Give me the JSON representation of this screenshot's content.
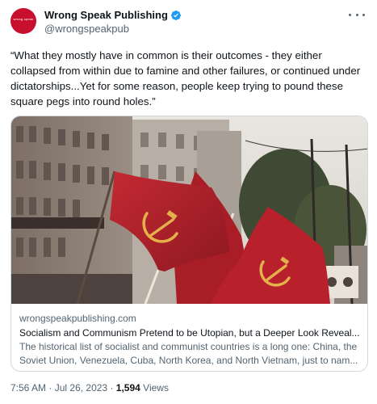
{
  "tweet": {
    "display_name": "Wrong Speak Publishing",
    "handle": "@wrongspeakpub",
    "avatar_text": "wrong speak",
    "text": "“What they mostly have in common is their outcomes - they either collapsed from within due to famine and other failures, or continued under dictatorships...Yet for some reason, people keep trying to pound these square pegs into round holes.”"
  },
  "card": {
    "domain": "wrongspeakpublishing.com",
    "title": "Socialism and Communism Pretend to be Utopian, but a Deeper Look Reveal...",
    "description": "The historical list of socialist and communist countries is a long one: China, the Soviet Union, Venezuela, Cuba, North Korea, and North Vietnam, just to nam..."
  },
  "meta": {
    "time": "7:56 AM",
    "separator": "·",
    "date": "Jul 26, 2023",
    "views_count": "1,594",
    "views_label": "Views"
  },
  "colors": {
    "accent": "#1d9bf0",
    "flag_red": "#b8202b",
    "avatar_red": "#c8102e",
    "secondary_text": "#536471"
  },
  "icons": [
    "verified-badge-icon",
    "more-options-icon"
  ]
}
